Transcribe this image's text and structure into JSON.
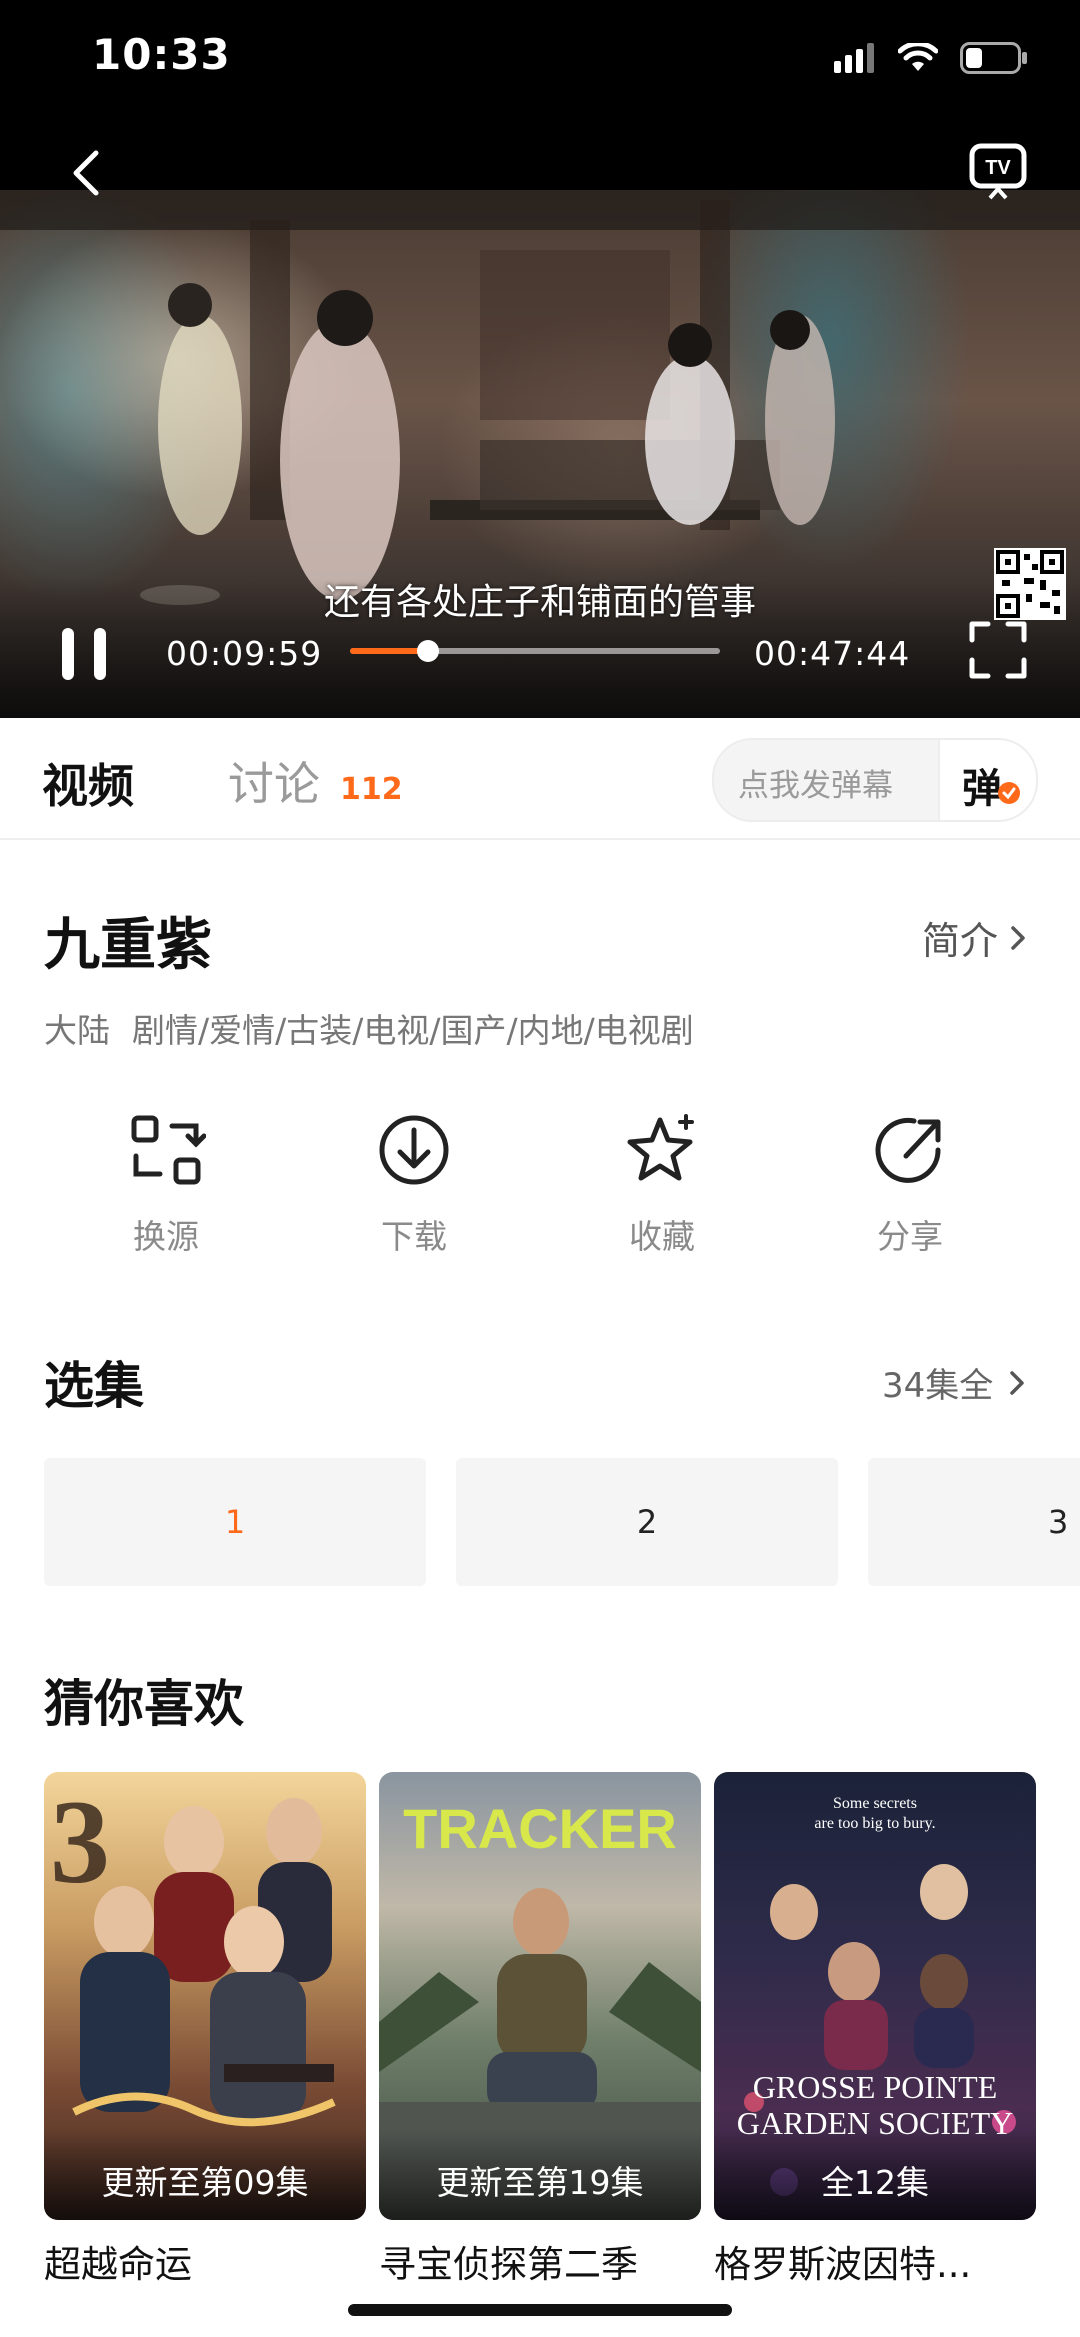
{
  "status_bar": {
    "time": "10:33"
  },
  "player": {
    "subtitle": "还有各处庄子和铺面的管事",
    "current_time": "00:09:59",
    "total_time": "00:47:44",
    "progress": 0.21
  },
  "tabs": {
    "video": "视频",
    "discuss": "讨论",
    "discuss_count": "112",
    "danmu_placeholder": "点我发弹幕",
    "danmu_button": "弹"
  },
  "show": {
    "title": "九重紫",
    "intro": "简介",
    "region": "大陆",
    "genres": "剧情/爱情/古装/电视/国产/内地/电视剧"
  },
  "actions": [
    {
      "label": "换源",
      "icon": "switch-source-icon"
    },
    {
      "label": "下载",
      "icon": "download-icon"
    },
    {
      "label": "收藏",
      "icon": "favorite-star-icon"
    },
    {
      "label": "分享",
      "icon": "share-icon"
    }
  ],
  "episodes": {
    "title": "选集",
    "count": "34集全",
    "items": [
      "1",
      "2",
      "3"
    ]
  },
  "recommend": {
    "title": "猜你喜欢",
    "items": [
      {
        "title": "超越命运",
        "badge": "更新至第09集"
      },
      {
        "title": "寻宝侦探第二季",
        "badge": "更新至第19集",
        "poster_text": "TRACKER"
      },
      {
        "title": "格罗斯波因特...",
        "badge": "全12集",
        "poster_text": "GROSSE POINTE GARDEN SOCIETY",
        "poster_tagline": "Some secrets are too big to bury."
      }
    ]
  },
  "colors": {
    "accent": "#ff6a1a",
    "tracker_yellow": "#d8e84a"
  }
}
